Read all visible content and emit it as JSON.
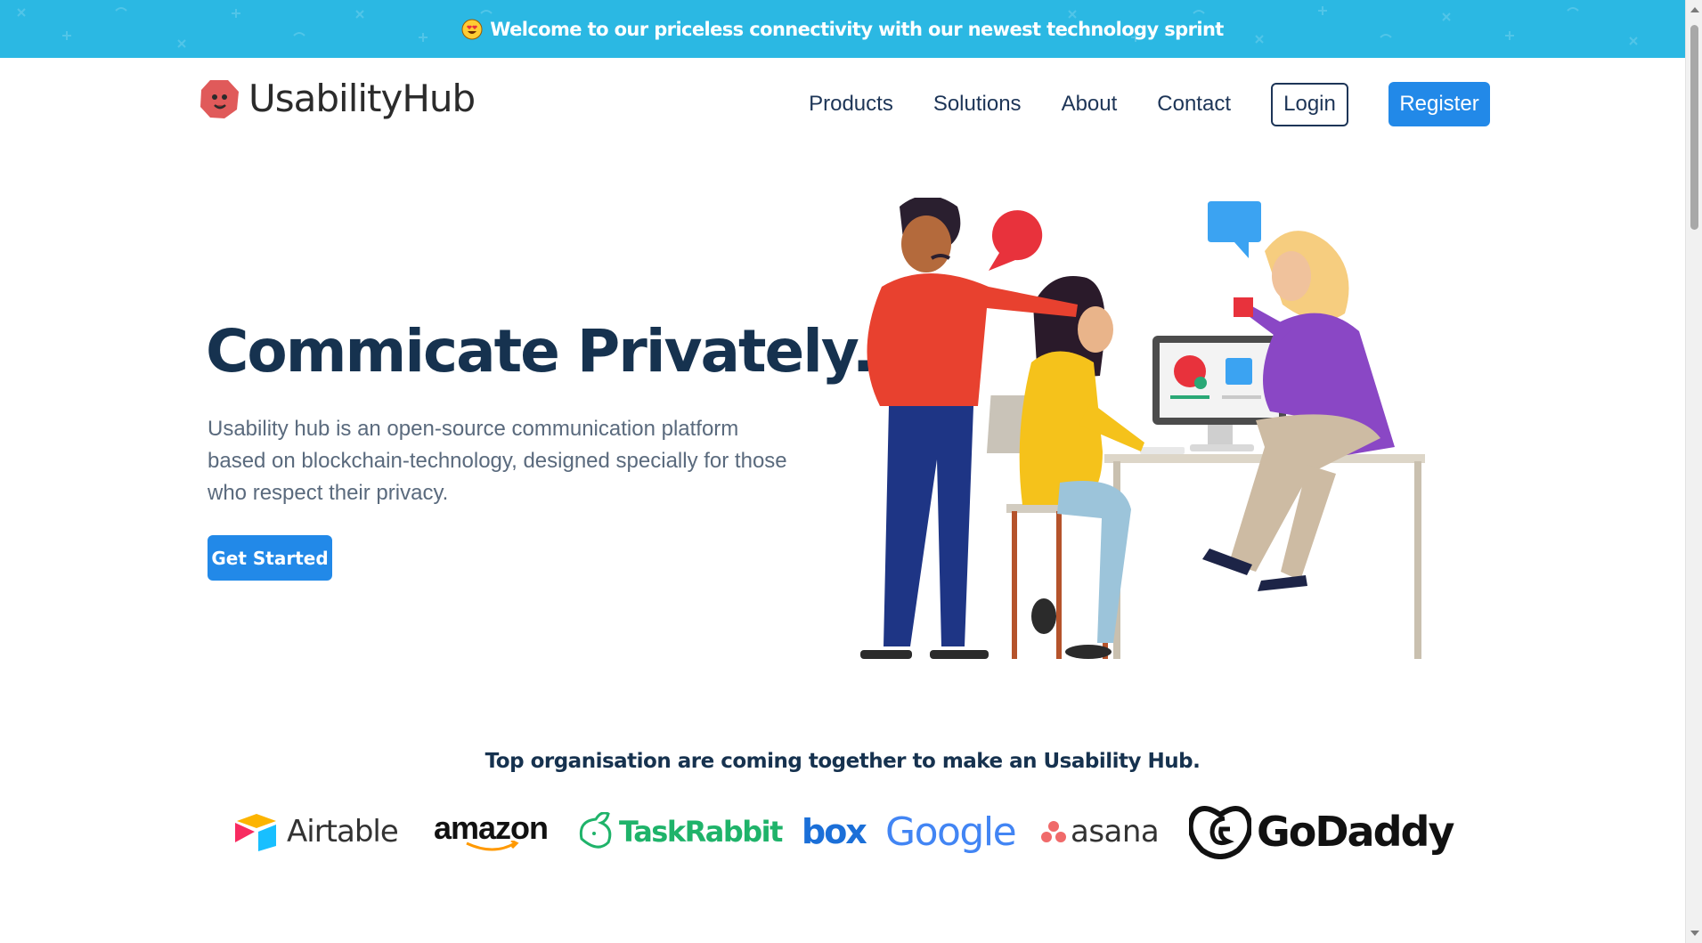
{
  "announcement": {
    "emoji_icon": "heart-eyes-emoji-icon",
    "text": "Welcome to our priceless connectivity with our newest technology sprint",
    "background": "#2bb8e3"
  },
  "header": {
    "logo_text": "UsabilityHub",
    "logo_color": "#e05a5a",
    "nav": [
      {
        "label": "Products"
      },
      {
        "label": "Solutions"
      },
      {
        "label": "About"
      },
      {
        "label": "Contact"
      }
    ],
    "login_label": "Login",
    "register_label": "Register",
    "accent": "#2289e8"
  },
  "hero": {
    "title": "Commicate Privately.",
    "description": "Usability hub is an open-source communication platform based on blockchain-technology, designed specially for those who respect their privacy.",
    "cta_label": "Get Started",
    "illustration": "team-collaboration-illustration"
  },
  "partners": {
    "heading": "Top organisation are coming together to make an Usability Hub.",
    "logos": [
      {
        "name": "Airtable",
        "icon": "airtable-icon"
      },
      {
        "name": "amazon",
        "icon": "amazon-smile-icon"
      },
      {
        "name": "TaskRabbit",
        "icon": "taskrabbit-icon"
      },
      {
        "name": "box"
      },
      {
        "name": "Google"
      },
      {
        "name": "asana",
        "icon": "asana-icon"
      },
      {
        "name": "GoDaddy",
        "icon": "godaddy-icon"
      }
    ]
  }
}
